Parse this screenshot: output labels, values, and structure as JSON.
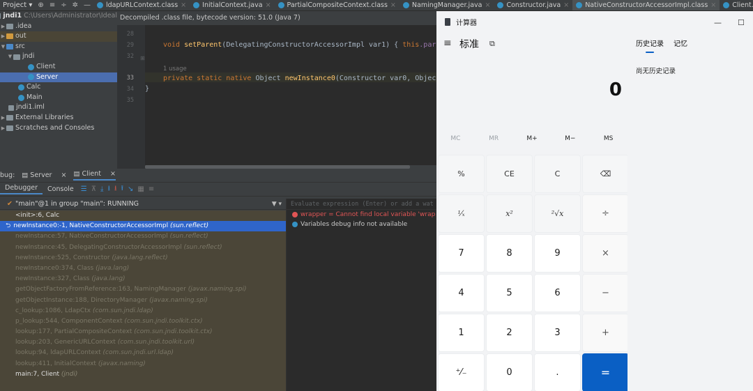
{
  "topbar": {
    "project_label": "Project",
    "tabs": [
      {
        "label": "ldapURLContext.class"
      },
      {
        "label": "InitialContext.java"
      },
      {
        "label": "PartialCompositeContext.class"
      },
      {
        "label": "NamingManager.java"
      },
      {
        "label": "Constructor.java"
      },
      {
        "label": "NativeConstructorAccessorImpl.class",
        "active": true
      },
      {
        "label": "Client.java"
      }
    ]
  },
  "tree": {
    "root_label": "jndi1",
    "root_path": "C:\\Users\\Administrator\\Ideal",
    "items": [
      "jndi1",
      ".idea",
      "out",
      "src",
      "jndi",
      "Client",
      "Server",
      "Calc",
      "Main",
      "jndi1.iml",
      "External Libraries",
      "Scratches and Consoles"
    ]
  },
  "editor": {
    "banner": "Decompiled .class file, bytecode version: 51.0 (Java 7)",
    "line_numbers": [
      "28",
      "29",
      "32",
      "33",
      "34",
      "35"
    ],
    "line29_pre": "void ",
    "line29_fn": "setParent",
    "line29_args": "(DelegatingConstructorAccessorImpl var1) { ",
    "line29_kw": "this",
    "line29_tail": ".paren",
    "usage": "1 usage",
    "line33_kw": "private static native ",
    "line33_type": "Object ",
    "line33_fn": "newInstance0",
    "line33_args": "(Constructor var0, Object",
    "line34": "}"
  },
  "debug": {
    "tabs": {
      "prefix": "bug:",
      "server": "Server",
      "client": "Client"
    },
    "subtabs": {
      "debugger": "Debugger",
      "console": "Console"
    },
    "thread": "\"main\"@1 in group \"main\": RUNNING",
    "frames": [
      {
        "method": "<init>:6, Calc",
        "pkg": ""
      },
      {
        "method": "newInstance0:-1, NativeConstructorAccessorImpl",
        "pkg": "(sun.reflect)"
      },
      {
        "method": "newInstance:57, NativeConstructorAccessorImpl",
        "pkg": "(sun.reflect)"
      },
      {
        "method": "newInstance:45, DelegatingConstructorAccessorImpl",
        "pkg": "(sun.reflect)"
      },
      {
        "method": "newInstance:525, Constructor",
        "pkg": "(java.lang.reflect)"
      },
      {
        "method": "newInstance0:374, Class",
        "pkg": "(java.lang)"
      },
      {
        "method": "newInstance:327, Class",
        "pkg": "(java.lang)"
      },
      {
        "method": "getObjectFactoryFromReference:163, NamingManager",
        "pkg": "(javax.naming.spi)"
      },
      {
        "method": "getObjectInstance:188, DirectoryManager",
        "pkg": "(javax.naming.spi)"
      },
      {
        "method": "c_lookup:1086, LdapCtx",
        "pkg": "(com.sun.jndi.ldap)"
      },
      {
        "method": "p_lookup:544, ComponentContext",
        "pkg": "(com.sun.jndi.toolkit.ctx)"
      },
      {
        "method": "lookup:177, PartialCompositeContext",
        "pkg": "(com.sun.jndi.toolkit.ctx)"
      },
      {
        "method": "lookup:203, GenericURLContext",
        "pkg": "(com.sun.jndi.toolkit.url)"
      },
      {
        "method": "lookup:94, ldapURLContext",
        "pkg": "(com.sun.jndi.url.ldap)"
      },
      {
        "method": "lookup:411, InitialContext",
        "pkg": "(javax.naming)"
      },
      {
        "method": "main:7, Client",
        "pkg": "(jndi)"
      }
    ],
    "eval_placeholder": "Evaluate expression (Enter) or add a wat",
    "vars": [
      {
        "text": "wrapper = Cannot find local variable 'wrap",
        "kind": "err"
      },
      {
        "text": "Variables debug info not available",
        "kind": "info"
      }
    ]
  },
  "calculator": {
    "title": "计算器",
    "mode": "标准",
    "display": "0",
    "memory": [
      "MC",
      "MR",
      "M+",
      "M−",
      "MS"
    ],
    "keys": [
      "%",
      "CE",
      "C",
      "⌫",
      "¹⁄ₓ",
      "x²",
      "²√x",
      "÷",
      "7",
      "8",
      "9",
      "×",
      "4",
      "5",
      "6",
      "−",
      "1",
      "2",
      "3",
      "+",
      "⁺⁄₋",
      "0",
      ".",
      "="
    ],
    "history_tab": "历史记录",
    "memory_tab": "记忆",
    "history_empty": "尚无历史记录"
  }
}
